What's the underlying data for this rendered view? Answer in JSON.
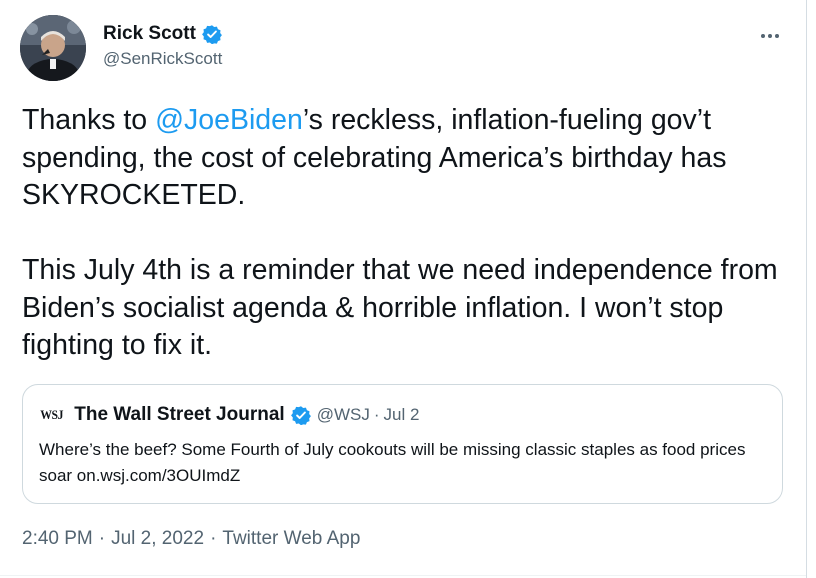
{
  "author": {
    "name": "Rick Scott",
    "handle": "@SenRickScott",
    "verified": true
  },
  "tweet": {
    "paragraph1": {
      "before": "Thanks to ",
      "mention": "@JoeBiden",
      "after": "’s reckless, inflation-fueling gov’t spending, the cost of celebrating America’s birthday has SKYROCKETED."
    },
    "paragraph2": "This July 4th is a reminder that we need independence from Biden’s socialist agenda & horrible inflation. I won’t stop fighting to fix it."
  },
  "quote": {
    "logo_text": "WSJ",
    "name": "The Wall Street Journal",
    "verified": true,
    "handle": "@WSJ",
    "separator": "·",
    "date": "Jul 2",
    "text": "Where’s the beef? Some Fourth of July cookouts will be missing classic staples as food prices soar ",
    "link": "on.wsj.com/3OUImdZ"
  },
  "meta": {
    "time": "2:40 PM",
    "separator": "·",
    "date": "Jul 2, 2022",
    "source": "Twitter Web App"
  },
  "colors": {
    "accent": "#1d9bf0",
    "text": "#0f1419",
    "secondary": "#536471",
    "border": "#cfd9de"
  },
  "icons": {
    "verified": "verified-badge-icon",
    "more": "more-horizontal-icon"
  }
}
